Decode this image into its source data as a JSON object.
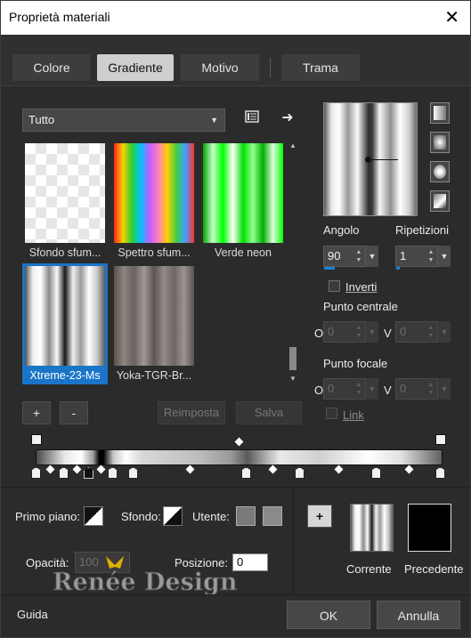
{
  "window": {
    "title": "Proprietà materiali"
  },
  "tabs": [
    {
      "label": "Colore",
      "active": false
    },
    {
      "label": "Gradiente",
      "active": true
    },
    {
      "label": "Motivo",
      "active": false
    },
    {
      "label": "Trama",
      "active": false
    }
  ],
  "library": {
    "category": "Tutto",
    "items": [
      {
        "label": "Sfondo sfum...",
        "selected": false
      },
      {
        "label": "Spettro sfum...",
        "selected": false
      },
      {
        "label": "Verde neon",
        "selected": false
      },
      {
        "label": "Xtreme-23-Ms",
        "selected": true
      },
      {
        "label": "Yoka-TGR-Br...",
        "selected": false
      }
    ],
    "add_label": "+",
    "remove_label": "-",
    "reset_label": "Reimposta",
    "save_label": "Salva"
  },
  "angle": {
    "label": "Angolo",
    "value": "90",
    "progress": 0.25
  },
  "repeats": {
    "label": "Ripetizioni",
    "value": "1",
    "progress": 0.01
  },
  "invert": {
    "label": "Inverti",
    "checked": false
  },
  "center_point": {
    "label": "Punto centrale",
    "o_label": "O",
    "o_value": "0",
    "v_label": "V",
    "v_value": "0"
  },
  "focal_point": {
    "label": "Punto focale",
    "o_label": "O",
    "o_value": "0",
    "v_label": "V",
    "v_value": "0"
  },
  "link": {
    "label": "Link",
    "checked": false
  },
  "bottom": {
    "foreground_label": "Primo piano:",
    "background_label": "Sfondo:",
    "user_label": "Utente:",
    "opacity_label": "Opacità:",
    "opacity_value": "100",
    "position_label": "Posizione:",
    "position_value": "0",
    "add_label": "+"
  },
  "compare": {
    "current_label": "Corrente",
    "previous_label": "Precedente"
  },
  "footer": {
    "help_label": "Guida",
    "ok_label": "OK",
    "cancel_label": "Annulla"
  },
  "watermark_text": "Renée Design",
  "colors": {
    "accent": "#1e7fd6",
    "selection": "#1a75c8",
    "panel": "#2b2b2b"
  }
}
